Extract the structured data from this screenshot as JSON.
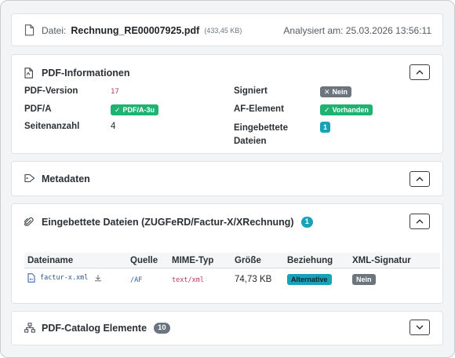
{
  "file": {
    "label": "Datei:",
    "name": "Rechnung_RE00007925.pdf",
    "size": "(433,45 KB)",
    "analyzed": "Analysiert am: 25.03.2026 13:56:11"
  },
  "pdf_info": {
    "title": "PDF-Informationen",
    "rows_left": [
      {
        "key": "PDF-Version",
        "value": "17"
      },
      {
        "key": "PDF/A",
        "value": "PDF/A-3u"
      },
      {
        "key": "Seitenanzahl",
        "value": "4"
      }
    ],
    "rows_right": [
      {
        "key": "Signiert",
        "value": "Nein"
      },
      {
        "key": "AF-Element",
        "value": "Vorhanden"
      },
      {
        "key": "Eingebettete Dateien",
        "value": "1"
      }
    ]
  },
  "metadata": {
    "title": "Metadaten"
  },
  "embedded": {
    "title": "Eingebettete Dateien (ZUGFeRD/Factur-X/XRechnung)",
    "count": "1",
    "columns": [
      "Dateiname",
      "Quelle",
      "MIME-Typ",
      "Größe",
      "Beziehung",
      "XML-Signatur"
    ],
    "rows": [
      {
        "filename": "factur-x.xml",
        "source": "/AF",
        "mime": "text/xml",
        "size": "74,73 KB",
        "relation": "Alternative",
        "signature": "Nein"
      }
    ]
  },
  "catalog": {
    "title": "PDF-Catalog Elemente",
    "count": "10"
  },
  "colors": {
    "green": "#20b270",
    "teal": "#17a2b8",
    "grey": "#6c757d",
    "code_red": "#c0395a",
    "link_blue": "#2a5a96"
  }
}
